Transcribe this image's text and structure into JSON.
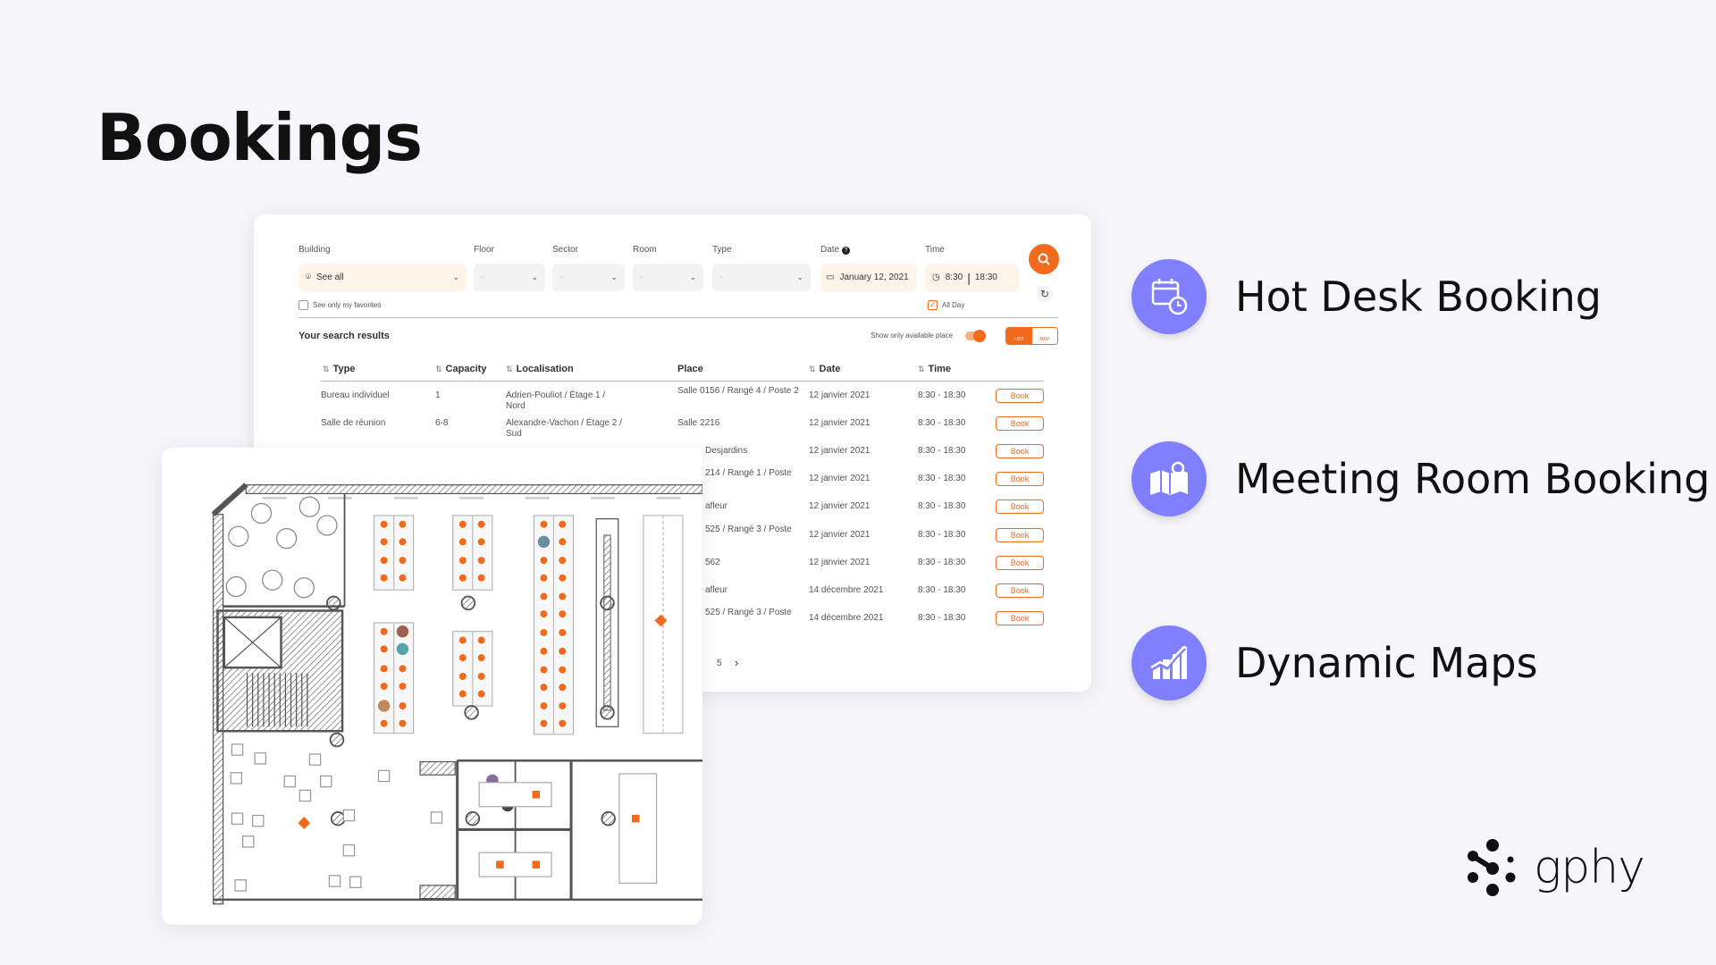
{
  "page": {
    "title": "Bookings"
  },
  "filters": {
    "building": {
      "label": "Building",
      "value": "See all"
    },
    "floor": {
      "label": "Floor",
      "value": "-"
    },
    "sector": {
      "label": "Sector",
      "value": "-"
    },
    "room": {
      "label": "Room",
      "value": "-"
    },
    "type": {
      "label": "Type",
      "value": "-"
    },
    "date": {
      "label": "Date",
      "value": "January 12, 2021"
    },
    "time": {
      "label": "Time",
      "start": "8:30",
      "end": "18:30"
    },
    "favorites_label": "See only my favorites",
    "all_day_label": "All Day",
    "all_day_checked": true
  },
  "results": {
    "heading": "Your search results",
    "available_toggle_label": "Show only available place",
    "available_toggle_on": true,
    "view_list": "LIST",
    "view_map": "MAP",
    "columns": [
      "Type",
      "Capacity",
      "Localisation",
      "Place",
      "Date",
      "Time"
    ],
    "rows": [
      {
        "type": "Bureau individuel",
        "capacity": "1",
        "localisation": "Adrien-Pouliot / Étage 1 / Nord",
        "place": "Salle 0156 / Rangé 4 / Poste 2",
        "date": "12 janvier 2021",
        "time": "8:30 - 18:30",
        "action": "Book"
      },
      {
        "type": "Salle de réunion",
        "capacity": "6-8",
        "localisation": "Alexandre-Vachon / Étage 2 / Sud",
        "place": "Salle 2216",
        "date": "12 janvier 2021",
        "time": "8:30 - 18:30",
        "action": "Book"
      },
      {
        "type": "",
        "capacity": "",
        "localisation": "",
        "place": "Desjardins",
        "date": "12 janvier 2021",
        "time": "8:30 - 18:30",
        "action": "Book"
      },
      {
        "type": "",
        "capacity": "",
        "localisation": "",
        "place": "214 / Rangé 1 / Poste",
        "date": "12 janvier 2021",
        "time": "8:30 - 18:30",
        "action": "Book"
      },
      {
        "type": "",
        "capacity": "",
        "localisation": "",
        "place": "afleur",
        "date": "12 janvier 2021",
        "time": "8:30 - 18:30",
        "action": "Book"
      },
      {
        "type": "",
        "capacity": "",
        "localisation": "",
        "place": "525 / Rangé 3 / Poste",
        "date": "12 janvier 2021",
        "time": "8:30 - 18:30",
        "action": "Book"
      },
      {
        "type": "",
        "capacity": "",
        "localisation": "",
        "place": "562",
        "date": "12 janvier 2021",
        "time": "8:30 - 18:30",
        "action": "Book"
      },
      {
        "type": "",
        "capacity": "",
        "localisation": "",
        "place": "afleur",
        "date": "14 décembre 2021",
        "time": "8:30 - 18:30",
        "action": "Book"
      },
      {
        "type": "",
        "capacity": "",
        "localisation": "",
        "place": "525 / Rangé 3 / Poste",
        "date": "14 décembre 2021",
        "time": "8:30 - 18:30",
        "action": "Book"
      }
    ],
    "pagination": {
      "page": "5",
      "next": "›"
    }
  },
  "features": [
    {
      "label": "Hot Desk Booking",
      "icon": "calendar-clock-icon"
    },
    {
      "label": "Meeting Room Booking",
      "icon": "map-pin-icon"
    },
    {
      "label": "Dynamic Maps",
      "icon": "chart-growth-icon"
    }
  ],
  "logo": {
    "text": "gphy"
  },
  "colors": {
    "accent": "#f26a1b",
    "feature_circle": "#8080ff",
    "background": "#f5f5fa"
  }
}
